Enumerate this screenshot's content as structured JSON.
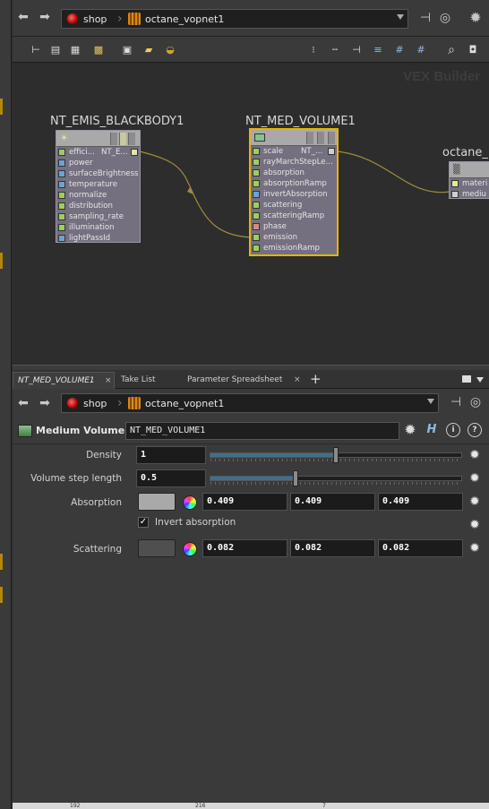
{
  "top_path": {
    "root": "shop",
    "child": "octane_vopnet1"
  },
  "network": {
    "context_label": "VEX Builder",
    "nodes": [
      {
        "title": "NT_EMIS_BLACKBODY1",
        "output_label": "NT_E...",
        "ports": [
          "effici...",
          "power",
          "surfaceBrightness",
          "temperature",
          "normalize",
          "distribution",
          "sampling_rate",
          "illumination",
          "lightPassId"
        ]
      },
      {
        "title": "NT_MED_VOLUME1",
        "output_label": "NT_...",
        "ports": [
          "scale",
          "rayMarchStepLe...",
          "absorption",
          "absorptionRamp",
          "invertAbsorption",
          "scattering",
          "scatteringRamp",
          "phase",
          "emission",
          "emissionRamp"
        ]
      },
      {
        "title": "octane_",
        "ports": [
          "materi",
          "mediu"
        ]
      }
    ]
  },
  "tabs": [
    {
      "label": "NT_MED_VOLUME1",
      "close": "×"
    },
    {
      "label": "Take List"
    },
    {
      "label": "Parameter Spreadsheet",
      "close": "×"
    }
  ],
  "tab_add": "+",
  "param_path": {
    "root": "shop",
    "child": "octane_vopnet1"
  },
  "params": {
    "node_type": "Medium Volume",
    "node_name": "NT_MED_VOLUME1",
    "help_h": "H",
    "info_i": "i",
    "help_q": "?",
    "density": {
      "label": "Density",
      "value": "1",
      "slider_fraction": 0.5
    },
    "step_length": {
      "label": "Volume step length",
      "value": "0.5",
      "slider_fraction": 0.34
    },
    "absorption": {
      "label": "Absorption",
      "color": "#a9a9a9",
      "r": "0.409",
      "g": "0.409",
      "b": "0.409"
    },
    "invert_absorption": {
      "label": "Invert absorption",
      "checked": true,
      "check_glyph": "✓"
    },
    "scattering": {
      "label": "Scattering",
      "color": "#4f4f4f",
      "r": "0.082",
      "g": "0.082",
      "b": "0.082"
    }
  },
  "ruler": {
    "marks": [
      "192",
      "216",
      "7"
    ]
  }
}
